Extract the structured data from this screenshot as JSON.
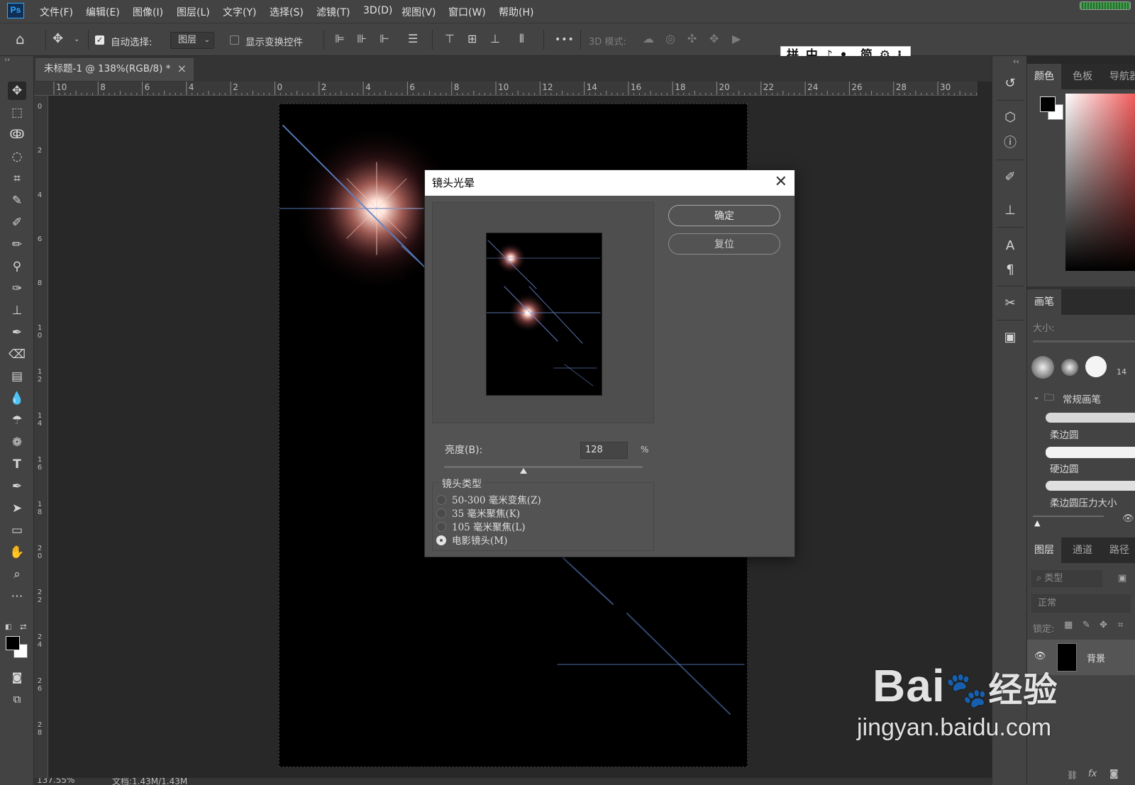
{
  "app": {
    "logo": "Ps"
  },
  "menu": [
    "文件(F)",
    "编辑(E)",
    "图像(I)",
    "图层(L)",
    "文字(Y)",
    "选择(S)",
    "滤镜(T)",
    "3D(D)",
    "视图(V)",
    "窗口(W)",
    "帮助(H)"
  ],
  "options": {
    "auto_select_label": "自动选择:",
    "layer_select_value": "图层",
    "show_transform_label": "显示变换控件",
    "more_label": "•••",
    "mode_3d_label": "3D 模式:"
  },
  "ime": {
    "text": "拼 中 ♪ •, 简 ⚙ ⁝"
  },
  "document": {
    "tab_title": "未标题-1 @ 138%(RGB/8) *",
    "status_zoom": "137.55%",
    "status_doc": "文档:1.43M/1.43M"
  },
  "rulers": {
    "top": [
      "10",
      "8",
      "6",
      "4",
      "2",
      "0",
      "2",
      "4",
      "6",
      "8",
      "10",
      "12",
      "14",
      "16",
      "18",
      "20",
      "22",
      "24",
      "26",
      "28",
      "30"
    ],
    "left": [
      "0",
      "2",
      "4",
      "6",
      "8",
      "1 0",
      "1 2",
      "1 4",
      "1 6",
      "1 8",
      "2 0",
      "2 2",
      "2 4",
      "2 6",
      "2 8"
    ]
  },
  "dialog": {
    "title": "镜头光晕",
    "ok_label": "确定",
    "reset_label": "复位",
    "brightness_label": "亮度(B):",
    "brightness_value": "128",
    "brightness_unit": "%",
    "brightness_fraction": 0.4,
    "lens_group_label": "镜头类型",
    "lens_types": [
      {
        "label": "50-300 毫米变焦(Z)",
        "selected": false
      },
      {
        "label": "35 毫米聚焦(K)",
        "selected": false
      },
      {
        "label": "105 毫米聚焦(L)",
        "selected": false
      },
      {
        "label": "电影镜头(M)",
        "selected": true
      }
    ]
  },
  "panels": {
    "color_tabs": [
      "颜色",
      "色板",
      "导航器"
    ],
    "brush_tab": "画笔",
    "brush_size_label": "大小:",
    "brush_count": "14",
    "brush_group": "常规画笔",
    "brushes": [
      "柔边圆",
      "硬边圆",
      "柔边圆压力大小"
    ],
    "layer_tabs": [
      "图层",
      "通道",
      "路径"
    ],
    "layer_filter_placeholder": "类型",
    "blend_mode": "正常",
    "lock_label": "锁定:",
    "layer_name": "背景",
    "footer_icons": [
      "link-icon",
      "fx-icon",
      "mask-icon"
    ],
    "fx_label": "fx"
  },
  "watermark": {
    "brand": "Bai",
    "brand_tail": "经验",
    "url": "jingyan.baidu.com"
  },
  "colors": {
    "accent": "#31a8ff",
    "flare": "#f0a090",
    "streak": "#5b82c8"
  }
}
